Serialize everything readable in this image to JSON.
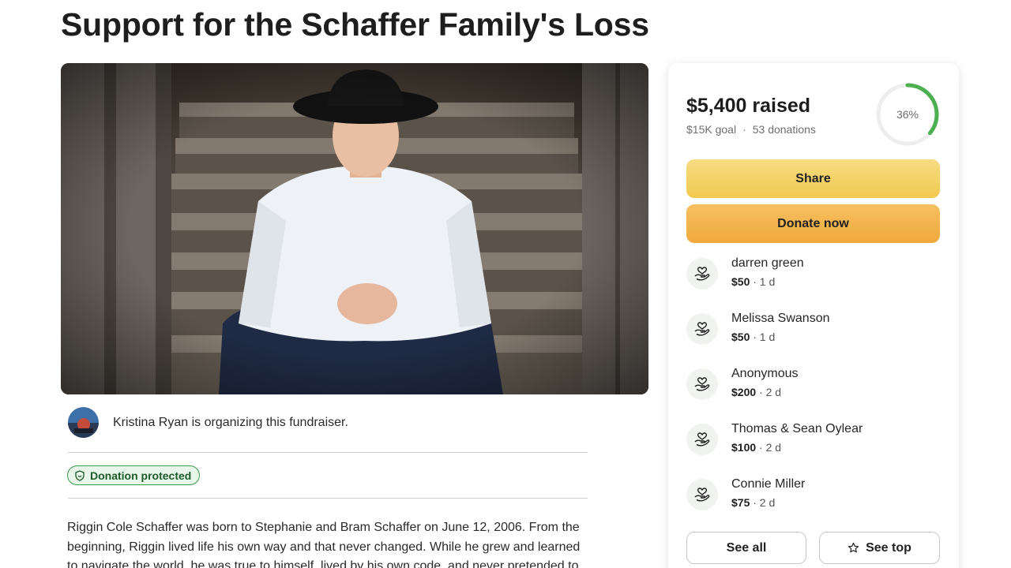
{
  "page": {
    "title": "Support for the Schaffer Family's Loss"
  },
  "organizer": {
    "text": "Kristina Ryan is organizing this fundraiser."
  },
  "badge": {
    "label": "Donation protected",
    "icon": "shield-icon"
  },
  "story": {
    "text": "Riggin Cole Schaffer was born to Stephanie and Bram Schaffer on June 12, 2006. From the beginning, Riggin lived life his own way and that never changed. While he grew and learned to navigate the world, he was true to himself, lived by his own code, and never pretended to"
  },
  "fundraiser": {
    "raised": "$5,400 raised",
    "goal": "$15K goal",
    "separator": "·",
    "donations_count": "53 donations",
    "progress_label": "36%",
    "progress_fraction": 0.36,
    "progress_color": "#4caf50"
  },
  "actions": {
    "share_label": "Share",
    "donate_label": "Donate now",
    "see_all_label": "See all",
    "see_top_label": "See top"
  },
  "donations": [
    {
      "name": "darren green",
      "amount": "$50",
      "time": "· 1 d"
    },
    {
      "name": "Melissa Swanson",
      "amount": "$50",
      "time": "· 1 d"
    },
    {
      "name": "Anonymous",
      "amount": "$200",
      "time": "· 2 d"
    },
    {
      "name": "Thomas & Sean Oylear",
      "amount": "$100",
      "time": "· 2 d"
    },
    {
      "name": "Connie Miller",
      "amount": "$75",
      "time": "· 2 d"
    }
  ]
}
